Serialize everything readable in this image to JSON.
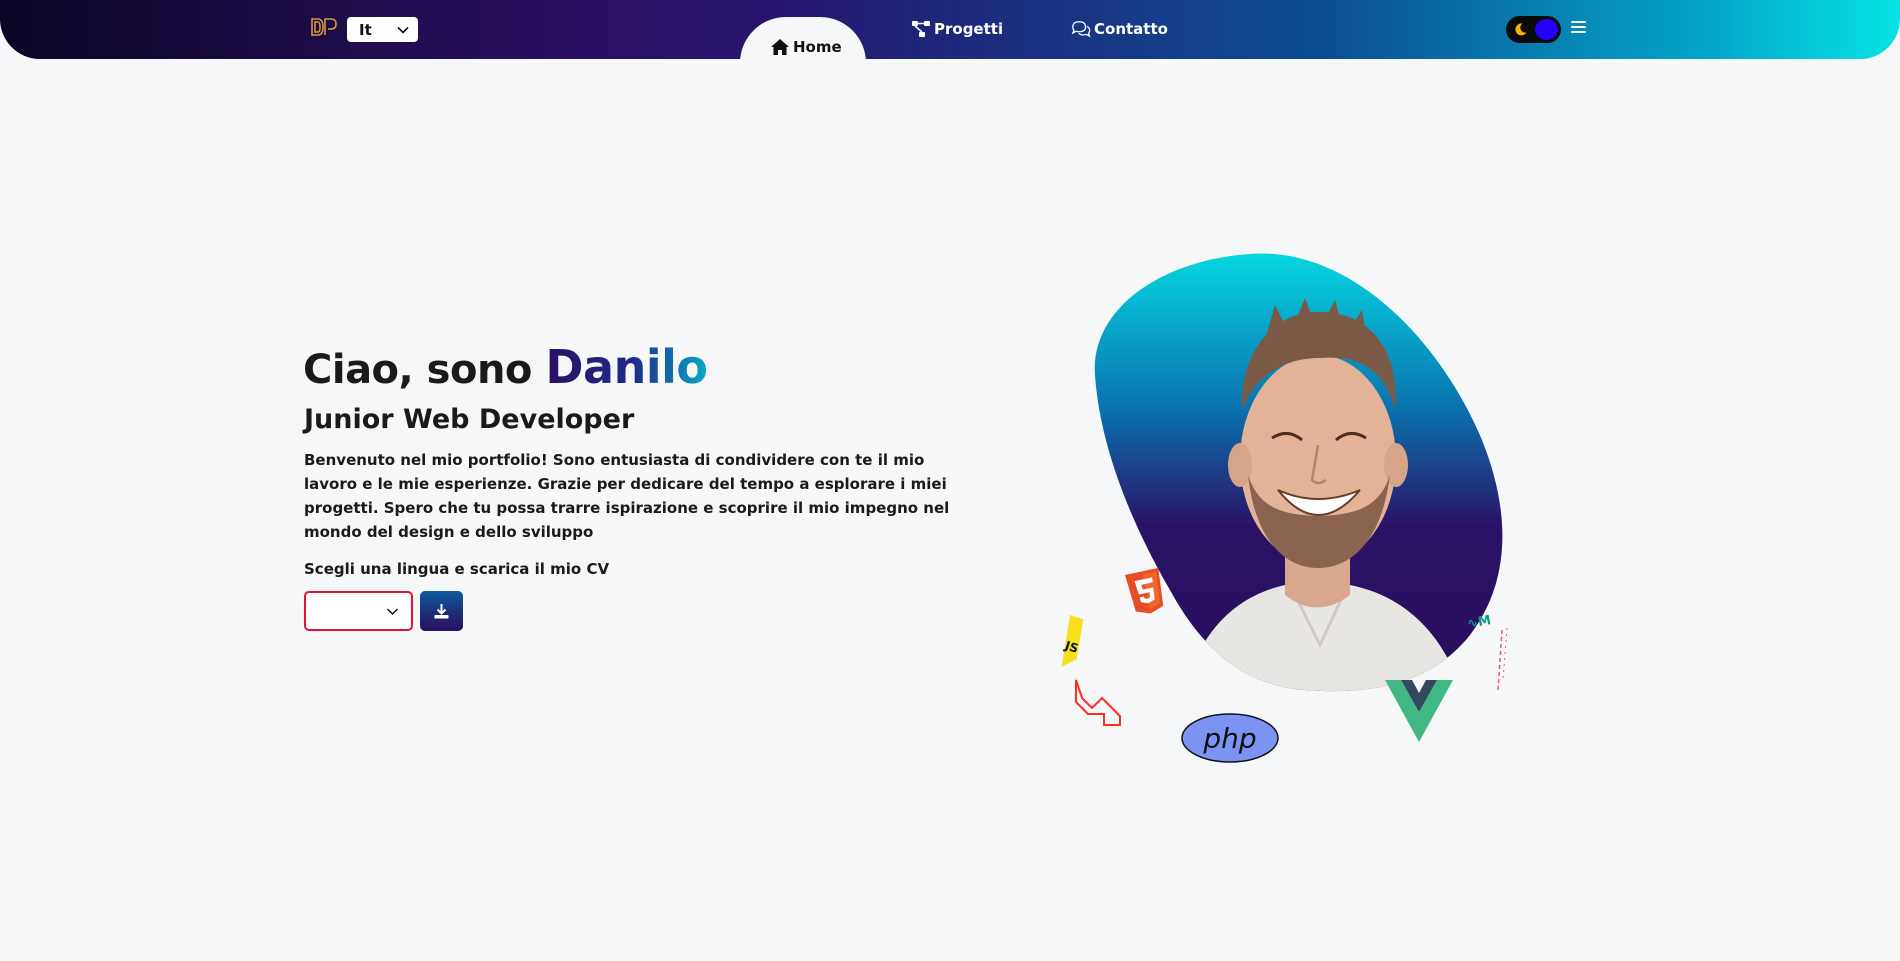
{
  "nav": {
    "language": "It",
    "home_label": "Home",
    "projects_label": "Progetti",
    "contact_label": "Contatto"
  },
  "hero": {
    "greeting_prefix": "Ciao, sono",
    "name": "Danilo",
    "role": "Junior Web Developer",
    "intro": "Benvenuto nel mio portfolio! Sono entusiasta di condividere con te il mio lavoro e le mie esperienze. Grazie per dedicare del tempo a esplorare i miei progetti. Spero che tu possa trarre ispirazione e scoprire il mio impegno nel mondo del design e dello sviluppo",
    "cv_label": "Scegli una lingua e scarica il mio CV",
    "cv_selected": ""
  },
  "skills": {
    "php_label": "php"
  },
  "icons": {
    "logo": "dp-logo",
    "home": "house-icon",
    "projects": "project-diagram-icon",
    "contact": "comments-icon",
    "theme": "moon-icon",
    "menu": "hamburger-icon",
    "download": "download-icon"
  },
  "colors": {
    "accent_dark": "#2a0f63",
    "accent_cyan": "#08e3e6",
    "toggle_knob": "#2600ff",
    "select_border": "#e4122e",
    "page_bg": "#f5f7f9"
  }
}
